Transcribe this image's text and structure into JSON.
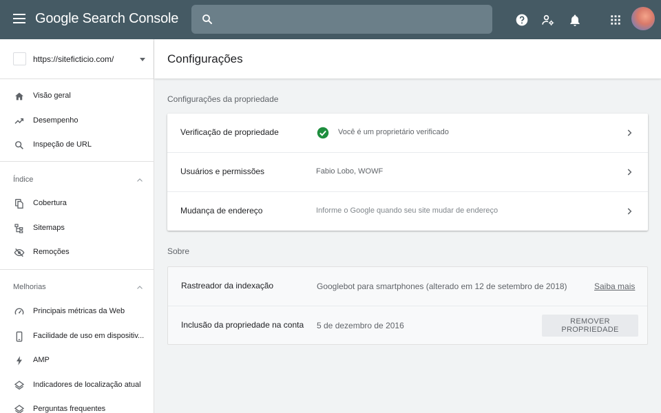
{
  "app": {
    "brand_google": "Google",
    "brand_product": "Search Console"
  },
  "search": {
    "placeholder": "",
    "value": ""
  },
  "colors": {
    "topbar": "#455a64",
    "search_bg": "#6b7f89",
    "check_green": "#1e8e3e",
    "main_bg": "#f1f3f4"
  },
  "topbar_icons": [
    "menu-icon",
    "search-icon",
    "help-icon",
    "manage-users-icon",
    "notifications-icon",
    "apps-grid-icon",
    "avatar"
  ],
  "sidebar": {
    "property_url": "https://siteficticio.com/",
    "top_items": [
      {
        "label": "Visão geral",
        "icon": "home-icon"
      },
      {
        "label": "Desempenho",
        "icon": "trending-up-icon"
      },
      {
        "label": "Inspeção de URL",
        "icon": "search-icon"
      }
    ],
    "sections": [
      {
        "title": "Índice",
        "items": [
          {
            "label": "Cobertura",
            "icon": "copy-icon"
          },
          {
            "label": "Sitemaps",
            "icon": "sitemap-icon"
          },
          {
            "label": "Remoções",
            "icon": "visibility-off-icon"
          }
        ]
      },
      {
        "title": "Melhorias",
        "items": [
          {
            "label": "Principais métricas da Web",
            "icon": "speed-icon"
          },
          {
            "label": "Facilidade de uso em dispositiv...",
            "icon": "smartphone-icon"
          },
          {
            "label": "AMP",
            "icon": "bolt-icon"
          },
          {
            "label": "Indicadores de localização atual",
            "icon": "layers-icon"
          },
          {
            "label": "Perguntas frequentes",
            "icon": "layers-icon"
          }
        ]
      }
    ]
  },
  "main": {
    "title": "Configurações",
    "property_settings": {
      "label": "Configurações da propriedade",
      "rows": [
        {
          "label": "Verificação de propriedade",
          "value": "Você é um proprietário verificado"
        },
        {
          "label": "Usuários e permissões",
          "value": "Fabio Lobo, WOWF"
        },
        {
          "label": "Mudança de endereço",
          "value": "Informe o Google quando seu site mudar de endereço"
        }
      ]
    },
    "about": {
      "label": "Sobre",
      "rows": [
        {
          "label": "Rastreador da indexação",
          "value": "Googlebot para smartphones (alterado em 12 de setembro de 2018)",
          "link": "Saiba mais"
        },
        {
          "label": "Inclusão da propriedade na conta",
          "value": "5 de dezembro de 2016",
          "button": "REMOVER PROPRIEDADE"
        }
      ]
    }
  }
}
